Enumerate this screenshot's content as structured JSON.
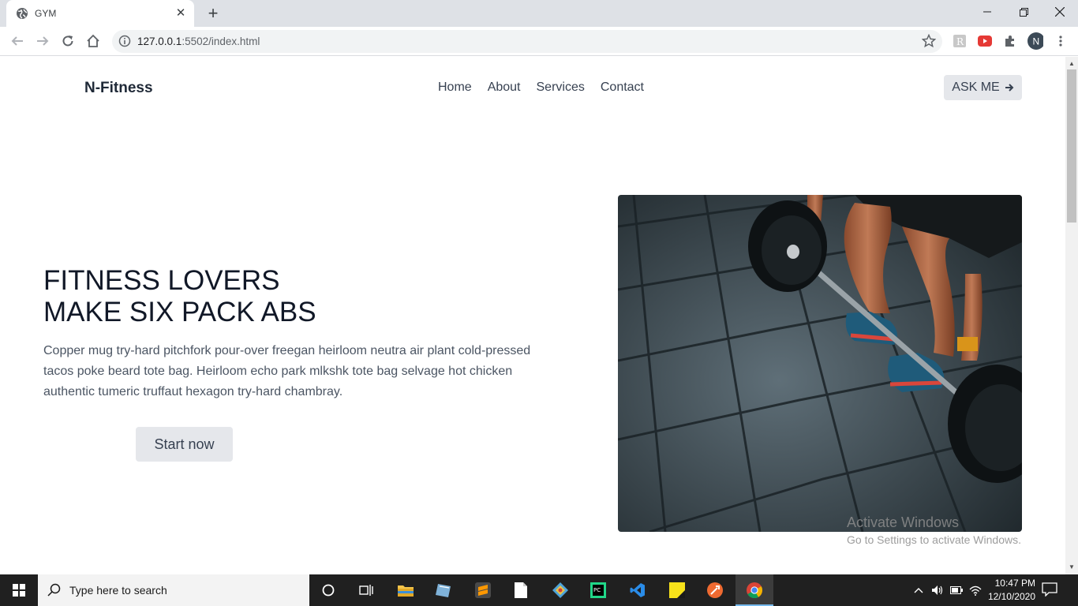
{
  "browser": {
    "tab_title": "GYM",
    "url_host": "127.0.0.1",
    "url_path": ":5502/index.html",
    "profile_initial": "N"
  },
  "site": {
    "brand": "N-Fitness",
    "nav": [
      "Home",
      "About",
      "Services",
      "Contact"
    ],
    "ask_button": "ASK ME",
    "hero_title_line1": "FITNESS LOVERS",
    "hero_title_line2": "MAKE SIX PACK ABS",
    "hero_text": "Copper mug try-hard pitchfork pour-over freegan heirloom neutra air plant cold-pressed tacos poke beard tote bag. Heirloom echo park mlkshk tote bag selvage hot chicken authentic tumeric truffaut hexagon try-hard chambray.",
    "start_button": "Start now"
  },
  "watermark": {
    "line1": "Activate Windows",
    "line2": "Go to Settings to activate Windows."
  },
  "taskbar": {
    "search_placeholder": "Type here to search",
    "time": "10:47 PM",
    "date": "12/10/2020"
  },
  "colors": {
    "accent": "#76b9ed",
    "button_bg": "#e5e7eb"
  }
}
